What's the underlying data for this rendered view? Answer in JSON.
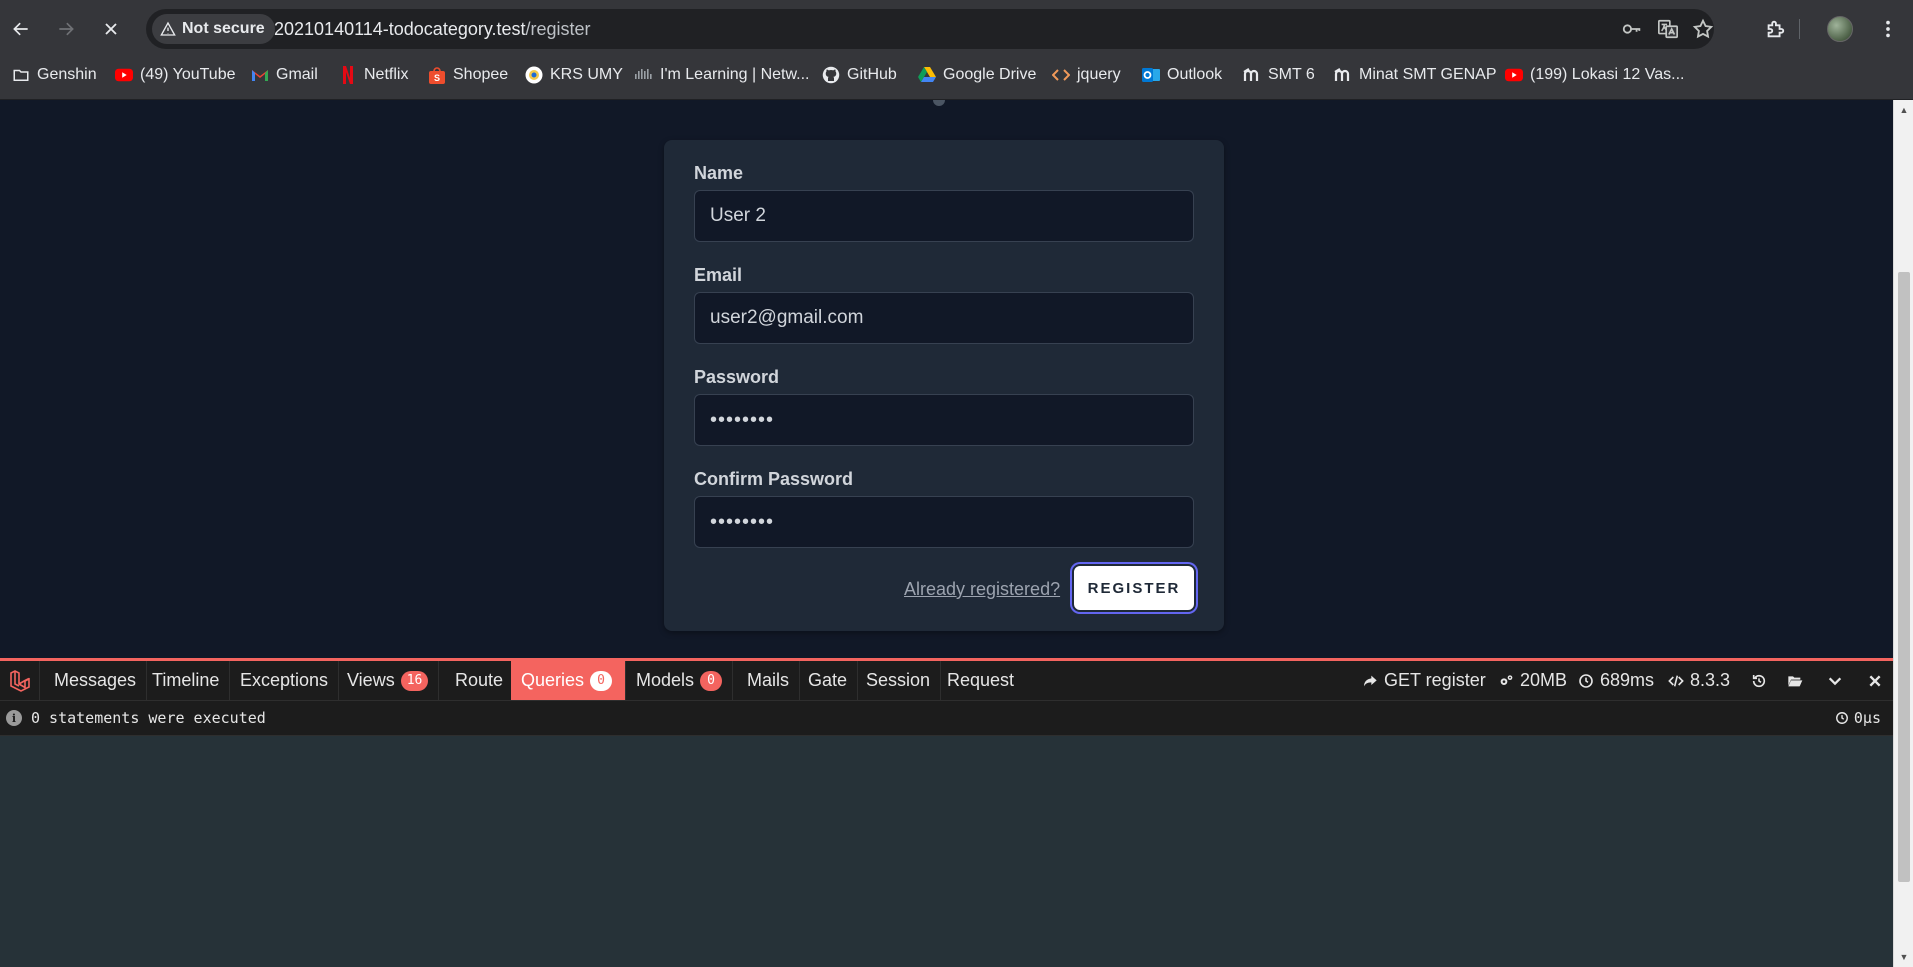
{
  "browser": {
    "security_label": "Not secure",
    "url_host": "20210140114-todocategory.test",
    "url_path": "/register",
    "icons": [
      "back-arrow-icon",
      "forward-arrow-icon",
      "stop-loading-icon",
      "warning-triangle-icon",
      "key-icon",
      "translate-icon",
      "star-icon",
      "extensions-icon",
      "profile-avatar",
      "kebab-menu-icon"
    ]
  },
  "bookmarks": [
    {
      "label": "Genshin",
      "icon": "folder-icon"
    },
    {
      "label": "(49) YouTube",
      "icon": "youtube-icon"
    },
    {
      "label": "Gmail",
      "icon": "gmail-icon"
    },
    {
      "label": "Netflix",
      "icon": "netflix-icon"
    },
    {
      "label": "Shopee",
      "icon": "shopee-icon"
    },
    {
      "label": "KRS UMY",
      "icon": "umy-icon"
    },
    {
      "label": "I'm Learning | Netw...",
      "icon": "cisco-icon"
    },
    {
      "label": "GitHub",
      "icon": "github-icon"
    },
    {
      "label": "Google Drive",
      "icon": "google-drive-icon"
    },
    {
      "label": "jquery",
      "icon": "code-icon"
    },
    {
      "label": "Outlook",
      "icon": "outlook-icon"
    },
    {
      "label": "SMT 6",
      "icon": "moodle-icon"
    },
    {
      "label": "Minat SMT GENAP",
      "icon": "moodle-icon"
    },
    {
      "label": "(199) Lokasi 12 Vas...",
      "icon": "youtube-icon"
    }
  ],
  "form": {
    "name_label": "Name",
    "name_value": "User 2",
    "email_label": "Email",
    "email_value": "user2@gmail.com",
    "password_label": "Password",
    "password_value": "••••••••",
    "confirm_label": "Confirm Password",
    "confirm_value": "••••••••",
    "already_link": "Already registered?",
    "register_button": "REGISTER"
  },
  "debugbar": {
    "tabs": [
      {
        "label": "Messages"
      },
      {
        "label": "Timeline"
      },
      {
        "label": "Exceptions"
      },
      {
        "label": "Views",
        "badge": "16"
      },
      {
        "label": "Route"
      },
      {
        "label": "Queries",
        "badge": "0",
        "active": true
      },
      {
        "label": "Models",
        "badge": "0"
      },
      {
        "label": "Mails"
      },
      {
        "label": "Gate"
      },
      {
        "label": "Session"
      },
      {
        "label": "Request"
      }
    ],
    "request": "GET register",
    "memory": "20MB",
    "duration": "689ms",
    "php_version": "8.3.3",
    "status_message": "0 statements were executed",
    "status_time": "0μs",
    "accent_color": "#f4645f"
  }
}
